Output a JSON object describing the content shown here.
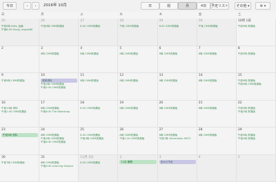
{
  "toolbar": {
    "today_label": "今日",
    "prev_icon": "chevron-left-icon",
    "next_icon": "chevron-right-icon",
    "month_label": "2016年 10月",
    "view_day": "日",
    "view_week": "週",
    "view_month": "月",
    "view_4day": "4日",
    "view_list": "予定リスト",
    "more_label": "その他",
    "settings_icon": "gear-icon"
  },
  "weekdays": [
    "日",
    "月",
    "火",
    "水",
    "木",
    "金",
    "土"
  ],
  "weeks": [
    {
      "days": [
        {
          "num": "25",
          "off": true,
          "events": [
            "午前9時 Daily 会議",
            "午後6:30 Study_rvspdn60"
          ]
        },
        {
          "num": "26",
          "off": true,
          "events": [
            "午前9時 CMM資源版"
          ]
        },
        {
          "num": "27",
          "off": true,
          "events": [
            "8:30 CMM資源版"
          ]
        },
        {
          "num": "28",
          "off": true,
          "events": [
            "午後 CMM資源版"
          ]
        },
        {
          "num": "29",
          "off": true,
          "events": [
            "8:30 CMM資源版"
          ]
        },
        {
          "num": "30",
          "off": true,
          "events": [
            "午後 CMM資源版"
          ]
        },
        {
          "num": "10月 1日",
          "off": false,
          "events": [
            "午前9時 資源版"
          ]
        }
      ]
    },
    {
      "days": [
        {
          "num": "2",
          "off": false,
          "events": []
        },
        {
          "num": "3",
          "off": false,
          "events": [
            "8時 CMM資源版"
          ]
        },
        {
          "num": "4",
          "off": false,
          "events": [
            "8時 CMM資源版"
          ]
        },
        {
          "num": "5",
          "off": false,
          "events": [
            "8時 CMM資源版"
          ]
        },
        {
          "num": "6",
          "off": false,
          "events": [
            "8時 CMM資源版"
          ]
        },
        {
          "num": "7",
          "off": false,
          "events": [
            "8時 CMM資源版"
          ]
        },
        {
          "num": "8",
          "off": false,
          "events": [
            "午前9時 資源版"
          ]
        }
      ]
    },
    {
      "days": [
        {
          "num": "9",
          "off": false,
          "events": [
            "午前9時 CMM資源版"
          ]
        },
        {
          "num": "10",
          "off": false,
          "events": [
            "午前9:30 Introduction",
            "午後1時 CMM資源版",
            "午後5:30 CMM資源版"
          ]
        },
        {
          "num": "11",
          "off": false,
          "events": [
            "8時 CMM資源版"
          ]
        },
        {
          "num": "12",
          "off": false,
          "events": [
            "8時 CMM資源版"
          ]
        },
        {
          "num": "13",
          "off": false,
          "events": [
            "8時 CMM資源版"
          ]
        },
        {
          "num": "14",
          "off": false,
          "events": [
            "8時 CMM資源版"
          ]
        },
        {
          "num": "15",
          "off": false,
          "events": [
            "午前9時 資源版",
            "午前9時 CMM資源版"
          ]
        }
      ]
    },
    {
      "days": [
        {
          "num": "16",
          "off": false,
          "events": [
            "午前10時 資料",
            "午後1:30 CMM資源版"
          ]
        },
        {
          "num": "17",
          "off": false,
          "events": [
            "8時 CMM資源版",
            "午後8:30 The Workshop"
          ]
        },
        {
          "num": "18",
          "off": false,
          "events": [
            "8:30 CMM資源版"
          ]
        },
        {
          "num": "19",
          "off": false,
          "events": [
            "8時 CMM資源版"
          ]
        },
        {
          "num": "20",
          "off": false,
          "events": [
            "8時 CMM資源版"
          ]
        },
        {
          "num": "21",
          "off": false,
          "events": [
            "8時 CMM資源版"
          ]
        },
        {
          "num": "22",
          "off": false,
          "events": [
            "午前9時 資源版",
            "午後2時 資源版"
          ]
        }
      ]
    },
    {
      "days": [
        {
          "num": "23",
          "off": false,
          "events": [
            "午後1時 CMM資源版"
          ]
        },
        {
          "num": "24",
          "off": false,
          "events": [
            "8時 CMM資源版",
            "午後1時 CMM資源版",
            "午後6:30 CMM資源版"
          ]
        },
        {
          "num": "25",
          "off": false,
          "events": [
            "8:30 CMM資源版",
            "午後3時 CMM資源版"
          ]
        },
        {
          "num": "26",
          "off": false,
          "events": [
            "8時 CMM資源版",
            "午後1:30 CMM資源版"
          ]
        },
        {
          "num": "27",
          "off": false,
          "events": [
            "8時 CMM資源版",
            "午後7時 Information MCF1"
          ]
        },
        {
          "num": "28",
          "off": false,
          "events": [
            "8時 CMM資源版"
          ]
        },
        {
          "num": "29",
          "off": false,
          "events": [
            "午前9時 資源版",
            "午後2時 資源版"
          ]
        }
      ]
    },
    {
      "days": [
        {
          "num": "30",
          "off": false,
          "events": [
            "午前7時 CMM資源版"
          ]
        },
        {
          "num": "31",
          "off": false,
          "events": [
            "8時 CMM資源版",
            "午後6:30 Learning Session"
          ]
        },
        {
          "num": "11月 1日",
          "off": true,
          "events": [
            "8:30 CMM資源版"
          ]
        },
        {
          "num": "2",
          "off": true,
          "events": [
            "8時 CMM資源版"
          ]
        },
        {
          "num": "3",
          "off": true,
          "events": []
        },
        {
          "num": "4",
          "off": true,
          "events": []
        },
        {
          "num": "5",
          "off": true,
          "events": []
        }
      ]
    }
  ],
  "bars": {
    "week3": {
      "label": "資料資料",
      "color": "#c9c6e6"
    },
    "week5": {
      "label": "午前9時 資料",
      "color": "#bde3c6"
    },
    "week6a": {
      "label": "11月 期間",
      "color": "#bde3c6"
    },
    "week6b": {
      "label": "あわせ予定",
      "color": "#c9c6e6"
    }
  }
}
